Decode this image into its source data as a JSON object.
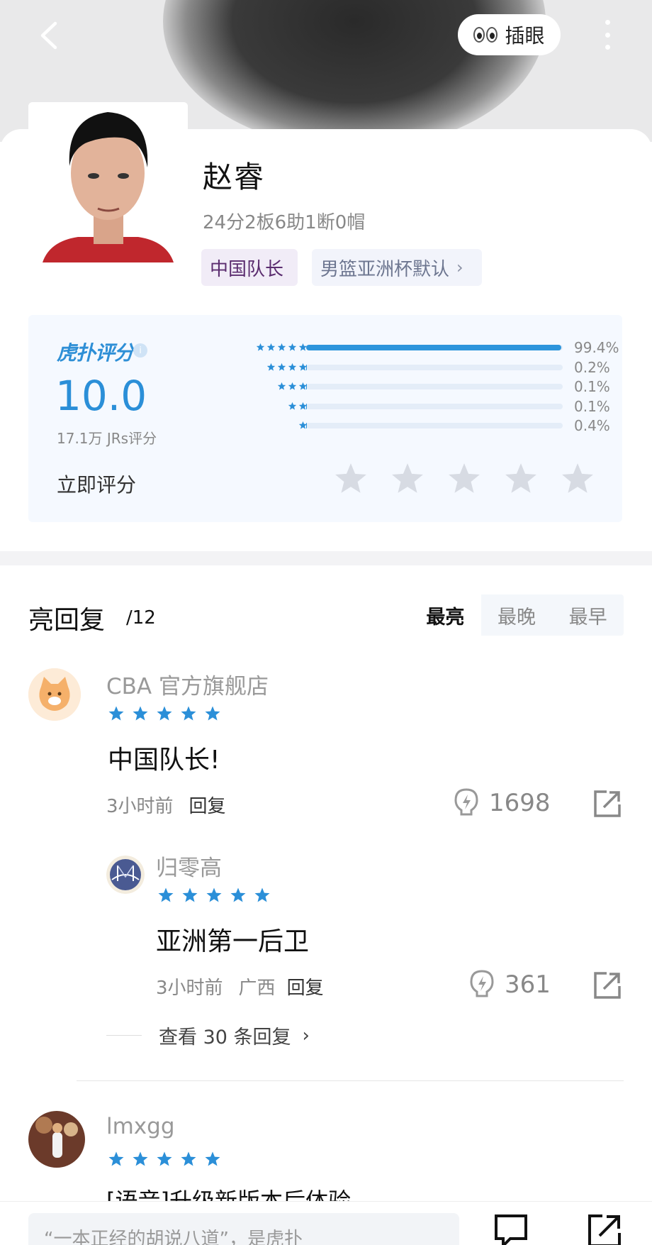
{
  "header": {
    "eyes_label": "插眼"
  },
  "player": {
    "name": "赵睿",
    "stats": "24分2板6助1断0帽",
    "tags": [
      "中国队长",
      "男篮亚洲杯默认"
    ]
  },
  "rating": {
    "brand": "虎扑评分",
    "score": "10.0",
    "count_text": "17.1万 JRs评分",
    "rate_now": "立即评分",
    "distribution": [
      {
        "stars": 5,
        "percent_label": "99.4%",
        "percent": 99.4
      },
      {
        "stars": 4,
        "percent_label": "0.2%",
        "percent": 0.2
      },
      {
        "stars": 3,
        "percent_label": "0.1%",
        "percent": 0.1
      },
      {
        "stars": 2,
        "percent_label": "0.1%",
        "percent": 0.1
      },
      {
        "stars": 1,
        "percent_label": "0.4%",
        "percent": 0.4
      }
    ]
  },
  "replies": {
    "title": "亮回复",
    "count": "/12",
    "sort_tabs": [
      "最亮",
      "最晚",
      "最早"
    ],
    "active_tab": "最亮",
    "items": [
      {
        "user": "CBA 官方旗舰店",
        "stars": 5,
        "text": "中国队长!",
        "time": "3小时前",
        "reply_label": "回复",
        "lights": "1698"
      },
      {
        "user": "归零高",
        "stars": 5,
        "text": "亚洲第一后卫",
        "time": "3小时前",
        "location": "广西",
        "reply_label": "回复",
        "lights": "361"
      }
    ],
    "view_more": "查看 30 条回复",
    "next_user": "lmxgg",
    "next_text": "[语音]升级新版本后体验"
  },
  "bottom_bar": {
    "input_placeholder": "“一本正经的胡说八道”，是虎扑"
  },
  "colors": {
    "accent": "#2b8fd8",
    "star_gray": "#d7dbe3",
    "tag_purple": "#5b2c6f"
  }
}
